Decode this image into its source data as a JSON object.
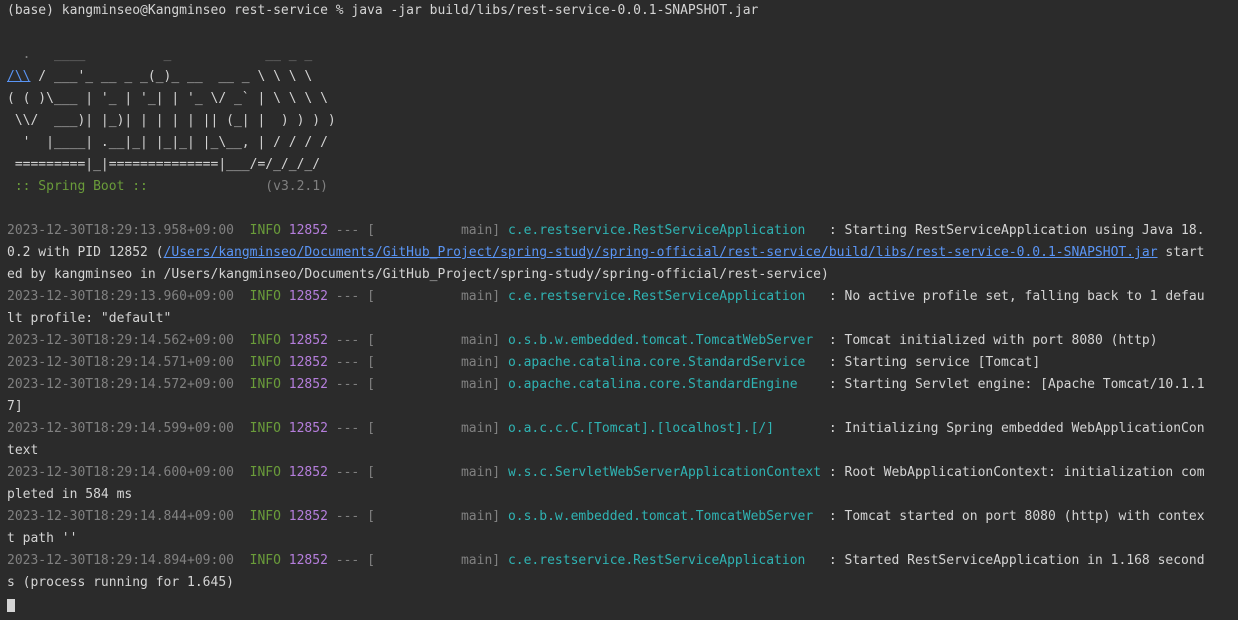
{
  "prompt_line": "(base) kangminseo@Kangminseo rest-service % java -jar build/libs/rest-service-0.0.1-SNAPSHOT.jar",
  "banner": {
    "l1": "  .   ____          _            __ _ _",
    "l2_link": "/\\\\",
    "l2_rest": " / ___'_ __ _ _(_)_ __  __ _ \\ \\ \\ \\",
    "l3": "( ( )\\___ | '_ | '_| | '_ \\/ _` | \\ \\ \\ \\",
    "l4": " \\\\/  ___)| |_)| | | | | || (_| |  ) ) ) )",
    "l5": "  '  |____| .__|_| |_|_| |_\\__, | / / / /",
    "l6": " =========|_|==============|___/=/_/_/_/",
    "l7_label": " :: Spring Boot :: ",
    "l7_version": "              (v3.2.1)"
  },
  "logs": [
    {
      "ts": "2023-12-30T18:29:13.958+09:00",
      "level": "INFO",
      "pid": "12852",
      "sep": "---",
      "thread": "[           main]",
      "logger": "c.e.restservice.RestServiceApplication  ",
      "msg": "Starting RestServiceApplication using Java 18.",
      "cont": [
        {
          "pre": "0.2 with PID 12852 (",
          "link": "/Users/kangminseo/Documents/GitHub_Project/spring-study/spring-official/rest-service/build/libs/rest-service-0.0.1-SNAPSHOT.jar",
          "post": " start"
        },
        {
          "pre": "ed by kangminseo in /Users/kangminseo/Documents/GitHub_Project/spring-study/spring-official/rest-service)",
          "link": "",
          "post": ""
        }
      ]
    },
    {
      "ts": "2023-12-30T18:29:13.960+09:00",
      "level": "INFO",
      "pid": "12852",
      "sep": "---",
      "thread": "[           main]",
      "logger": "c.e.restservice.RestServiceApplication  ",
      "msg": "No active profile set, falling back to 1 defau",
      "cont": [
        {
          "pre": "lt profile: \"default\"",
          "link": "",
          "post": ""
        }
      ]
    },
    {
      "ts": "2023-12-30T18:29:14.562+09:00",
      "level": "INFO",
      "pid": "12852",
      "sep": "---",
      "thread": "[           main]",
      "logger": "o.s.b.w.embedded.tomcat.TomcatWebServer ",
      "msg": "Tomcat initialized with port 8080 (http)",
      "cont": []
    },
    {
      "ts": "2023-12-30T18:29:14.571+09:00",
      "level": "INFO",
      "pid": "12852",
      "sep": "---",
      "thread": "[           main]",
      "logger": "o.apache.catalina.core.StandardService  ",
      "msg": "Starting service [Tomcat]",
      "cont": []
    },
    {
      "ts": "2023-12-30T18:29:14.572+09:00",
      "level": "INFO",
      "pid": "12852",
      "sep": "---",
      "thread": "[           main]",
      "logger": "o.apache.catalina.core.StandardEngine   ",
      "msg": "Starting Servlet engine: [Apache Tomcat/10.1.1",
      "cont": [
        {
          "pre": "7]",
          "link": "",
          "post": ""
        }
      ]
    },
    {
      "ts": "2023-12-30T18:29:14.599+09:00",
      "level": "INFO",
      "pid": "12852",
      "sep": "---",
      "thread": "[           main]",
      "logger": "o.a.c.c.C.[Tomcat].[localhost].[/]      ",
      "msg": "Initializing Spring embedded WebApplicationCon",
      "cont": [
        {
          "pre": "text",
          "link": "",
          "post": ""
        }
      ]
    },
    {
      "ts": "2023-12-30T18:29:14.600+09:00",
      "level": "INFO",
      "pid": "12852",
      "sep": "---",
      "thread": "[           main]",
      "logger": "w.s.c.ServletWebServerApplicationContext",
      "msg": "Root WebApplicationContext: initialization com",
      "cont": [
        {
          "pre": "pleted in 584 ms",
          "link": "",
          "post": ""
        }
      ]
    },
    {
      "ts": "2023-12-30T18:29:14.844+09:00",
      "level": "INFO",
      "pid": "12852",
      "sep": "---",
      "thread": "[           main]",
      "logger": "o.s.b.w.embedded.tomcat.TomcatWebServer ",
      "msg": "Tomcat started on port 8080 (http) with contex",
      "cont": [
        {
          "pre": "t path ''",
          "link": "",
          "post": ""
        }
      ]
    },
    {
      "ts": "2023-12-30T18:29:14.894+09:00",
      "level": "INFO",
      "pid": "12852",
      "sep": "---",
      "thread": "[           main]",
      "logger": "c.e.restservice.RestServiceApplication  ",
      "msg": "Started RestServiceApplication in 1.168 second",
      "cont": [
        {
          "pre": "s (process running for 1.645)",
          "link": "",
          "post": ""
        }
      ]
    }
  ]
}
